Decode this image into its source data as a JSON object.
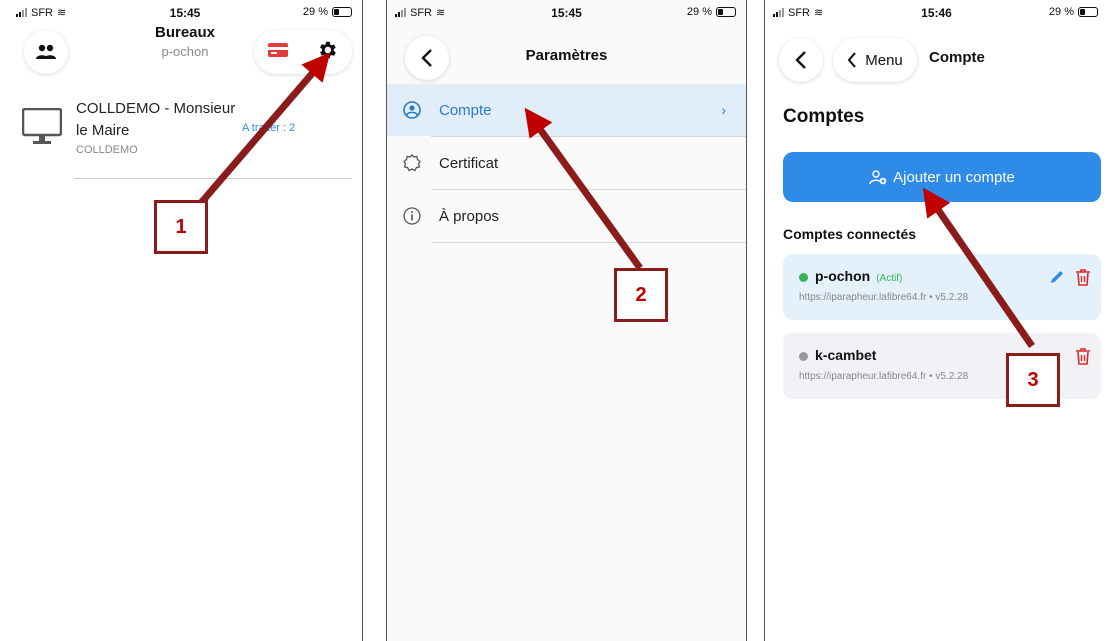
{
  "phone1": {
    "status": {
      "carrier": "SFR",
      "time": "15:45",
      "battery": "29 %"
    },
    "header": {
      "title": "Bureaux",
      "subtitle": "p-ochon"
    },
    "icons": {
      "users": "users-icon",
      "card": "card-icon",
      "settings": "gear-icon"
    },
    "desk": {
      "name": "COLLDEMO - Monsieur le Maire",
      "badge": "A traiter : 2",
      "code": "COLLDEMO"
    }
  },
  "phone2": {
    "status": {
      "carrier": "SFR",
      "time": "15:45",
      "battery": "29 %"
    },
    "header": {
      "title": "Paramètres"
    },
    "menu": [
      {
        "label": "Compte",
        "icon": "user-circle-icon",
        "active": true
      },
      {
        "label": "Certificat",
        "icon": "certificate-icon",
        "active": false
      },
      {
        "label": "À propos",
        "icon": "info-icon",
        "active": false
      }
    ]
  },
  "phone3": {
    "status": {
      "carrier": "SFR",
      "time": "15:46",
      "battery": "29 %"
    },
    "header": {
      "back_menu_label": "Menu",
      "title": "Compte"
    },
    "section_title": "Comptes",
    "add_button_label": "Ajouter un compte",
    "connected_label": "Comptes connectés",
    "accounts": [
      {
        "name": "p-ochon",
        "status": "(Actif)",
        "url": "https://iparapheur.lafibre64.fr • v5.2.28",
        "active": true
      },
      {
        "name": "k-cambet",
        "status": "",
        "url": "https://iparapheur.lafibre64.fr • v5.2.28",
        "active": false
      }
    ]
  },
  "callouts": [
    "1",
    "2",
    "3"
  ],
  "colors": {
    "accent": "#2e8ce8",
    "active_bg": "#e1eef9",
    "arrow": "#c00000",
    "active_dot": "#35b35a",
    "delete": "#d92c2c"
  }
}
